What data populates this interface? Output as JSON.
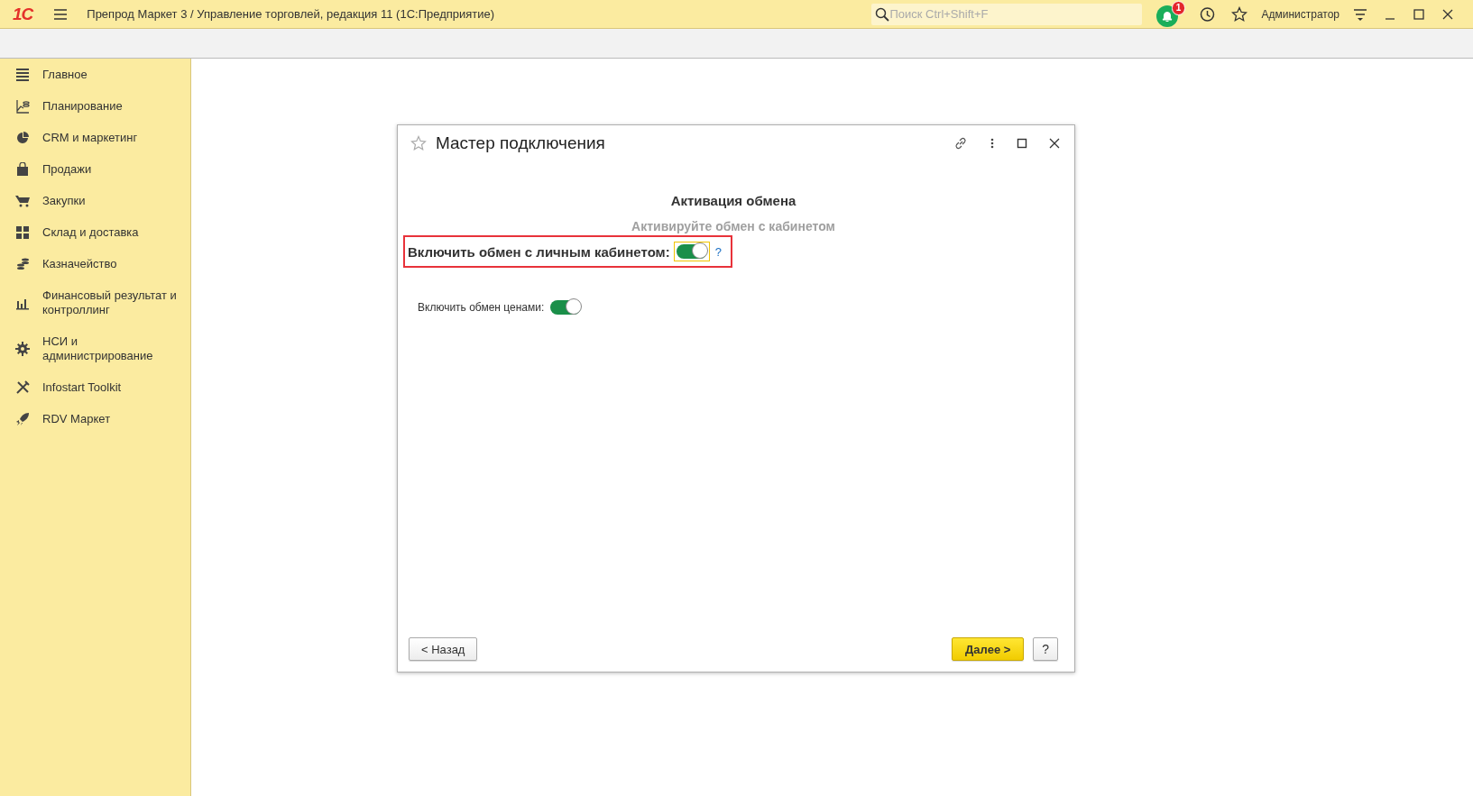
{
  "app_bar": {
    "logo": "1С",
    "title": "Препрод Маркет 3 / Управление торговлей, редакция 11  (1С:Предприятие)",
    "search": {
      "placeholder": "Поиск Ctrl+Shift+F"
    },
    "notifications": {
      "count": "1"
    },
    "user": "Администратор"
  },
  "sidebar": {
    "items": [
      {
        "label": "Главное"
      },
      {
        "label": "Планирование"
      },
      {
        "label": "CRM и маркетинг"
      },
      {
        "label": "Продажи"
      },
      {
        "label": "Закупки"
      },
      {
        "label": "Склад и доставка"
      },
      {
        "label": "Казначейство"
      },
      {
        "label": "Финансовый результат и контроллинг"
      },
      {
        "label": "НСИ и администрирование"
      },
      {
        "label": "Infostart Toolkit"
      },
      {
        "label": "RDV Маркет"
      }
    ]
  },
  "dialog": {
    "title": "Мастер подключения",
    "heading": "Активация обмена",
    "subheading": "Активируйте обмен с кабинетом",
    "fields": [
      {
        "label": "Включить обмен с личным кабинетом:",
        "on": true,
        "highlighted": true,
        "help": "?"
      },
      {
        "label": "Включить обмен ценами:",
        "on": true,
        "highlighted": false
      }
    ],
    "buttons": {
      "back": "< Назад",
      "next": "Далее >",
      "help": "?"
    }
  }
}
